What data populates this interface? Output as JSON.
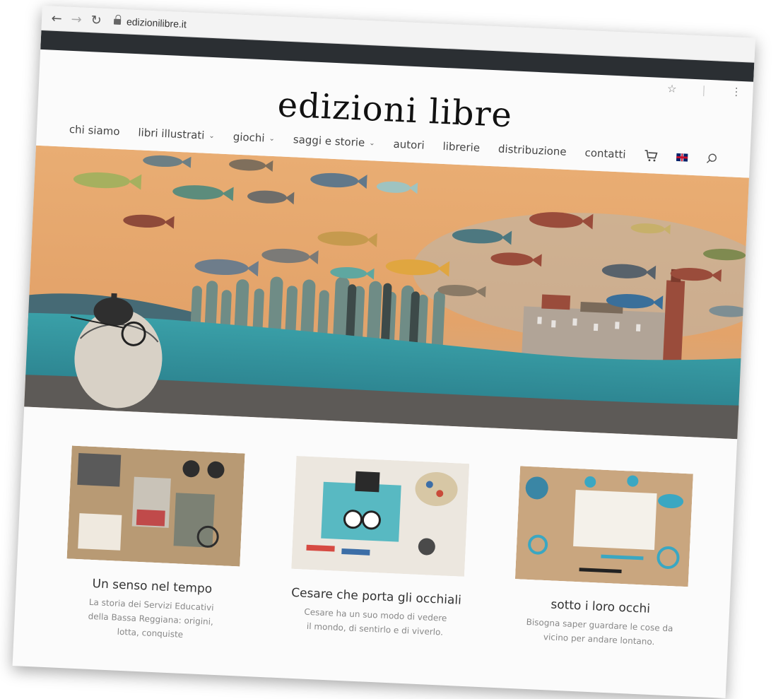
{
  "browser": {
    "url": "edizionilibre.it",
    "icons": {
      "back": "arrow-left-icon",
      "forward": "arrow-right-icon",
      "reload": "reload-icon",
      "lock": "lock-icon",
      "star": "star-icon",
      "menu": "kebab-menu-icon"
    }
  },
  "site": {
    "title": "edizioni libre",
    "menu": [
      {
        "label": "chi siamo",
        "dropdown": false
      },
      {
        "label": "libri illustrati",
        "dropdown": true
      },
      {
        "label": "giochi",
        "dropdown": true
      },
      {
        "label": "saggi e storie",
        "dropdown": true
      },
      {
        "label": "autori",
        "dropdown": false
      },
      {
        "label": "librerie",
        "dropdown": false
      },
      {
        "label": "distribuzione",
        "dropdown": false
      },
      {
        "label": "contatti",
        "dropdown": false
      }
    ],
    "menu_icons": {
      "cart": "cart-icon",
      "language": "uk-flag-icon",
      "search": "search-icon"
    }
  },
  "colors": {
    "dark_bar": "#2b2f33",
    "sky": "#e7a769",
    "water": "#3a9aa3",
    "title_text": "#111111",
    "body_text": "#888888"
  },
  "products": [
    {
      "title": "Un senso nel tempo",
      "description": "La storia dei Servizi Educativi della Bassa Reggiana: origini, lotta, conquiste"
    },
    {
      "title": "Cesare che porta gli occhiali",
      "description": "Cesare ha un suo modo di vedere il mondo, di sentirlo e di viverlo."
    },
    {
      "title": "sotto i loro occhi",
      "description": "Bisogna saper guardare le cose da vicino per andare lontano."
    }
  ]
}
